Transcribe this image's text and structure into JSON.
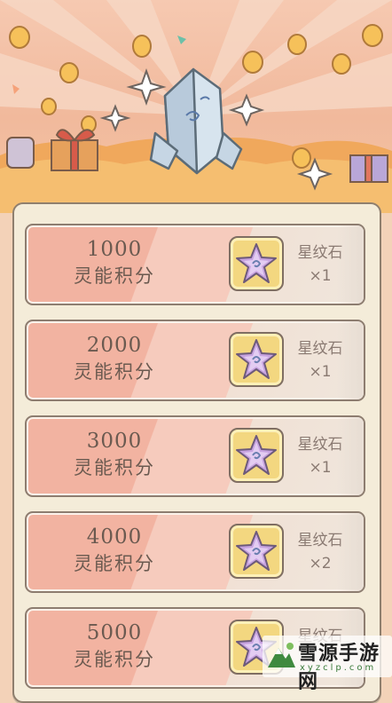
{
  "tiers": [
    {
      "points": "1000",
      "label": "灵能积分",
      "reward_name": "星纹石",
      "reward_qty": "×1"
    },
    {
      "points": "2000",
      "label": "灵能积分",
      "reward_name": "星纹石",
      "reward_qty": "×1"
    },
    {
      "points": "3000",
      "label": "灵能积分",
      "reward_name": "星纹石",
      "reward_qty": "×1"
    },
    {
      "points": "4000",
      "label": "灵能积分",
      "reward_name": "星纹石",
      "reward_qty": "×2"
    },
    {
      "points": "5000",
      "label": "灵能积分",
      "reward_name": "星纹石",
      "reward_qty": ""
    }
  ],
  "watermark": {
    "title": "雪源手游网",
    "url": "xyzclp.com"
  },
  "colors": {
    "accent_pink": "#f2b3a1",
    "slot_gold": "#f3d780",
    "star_purple": "#c7a3e0"
  }
}
